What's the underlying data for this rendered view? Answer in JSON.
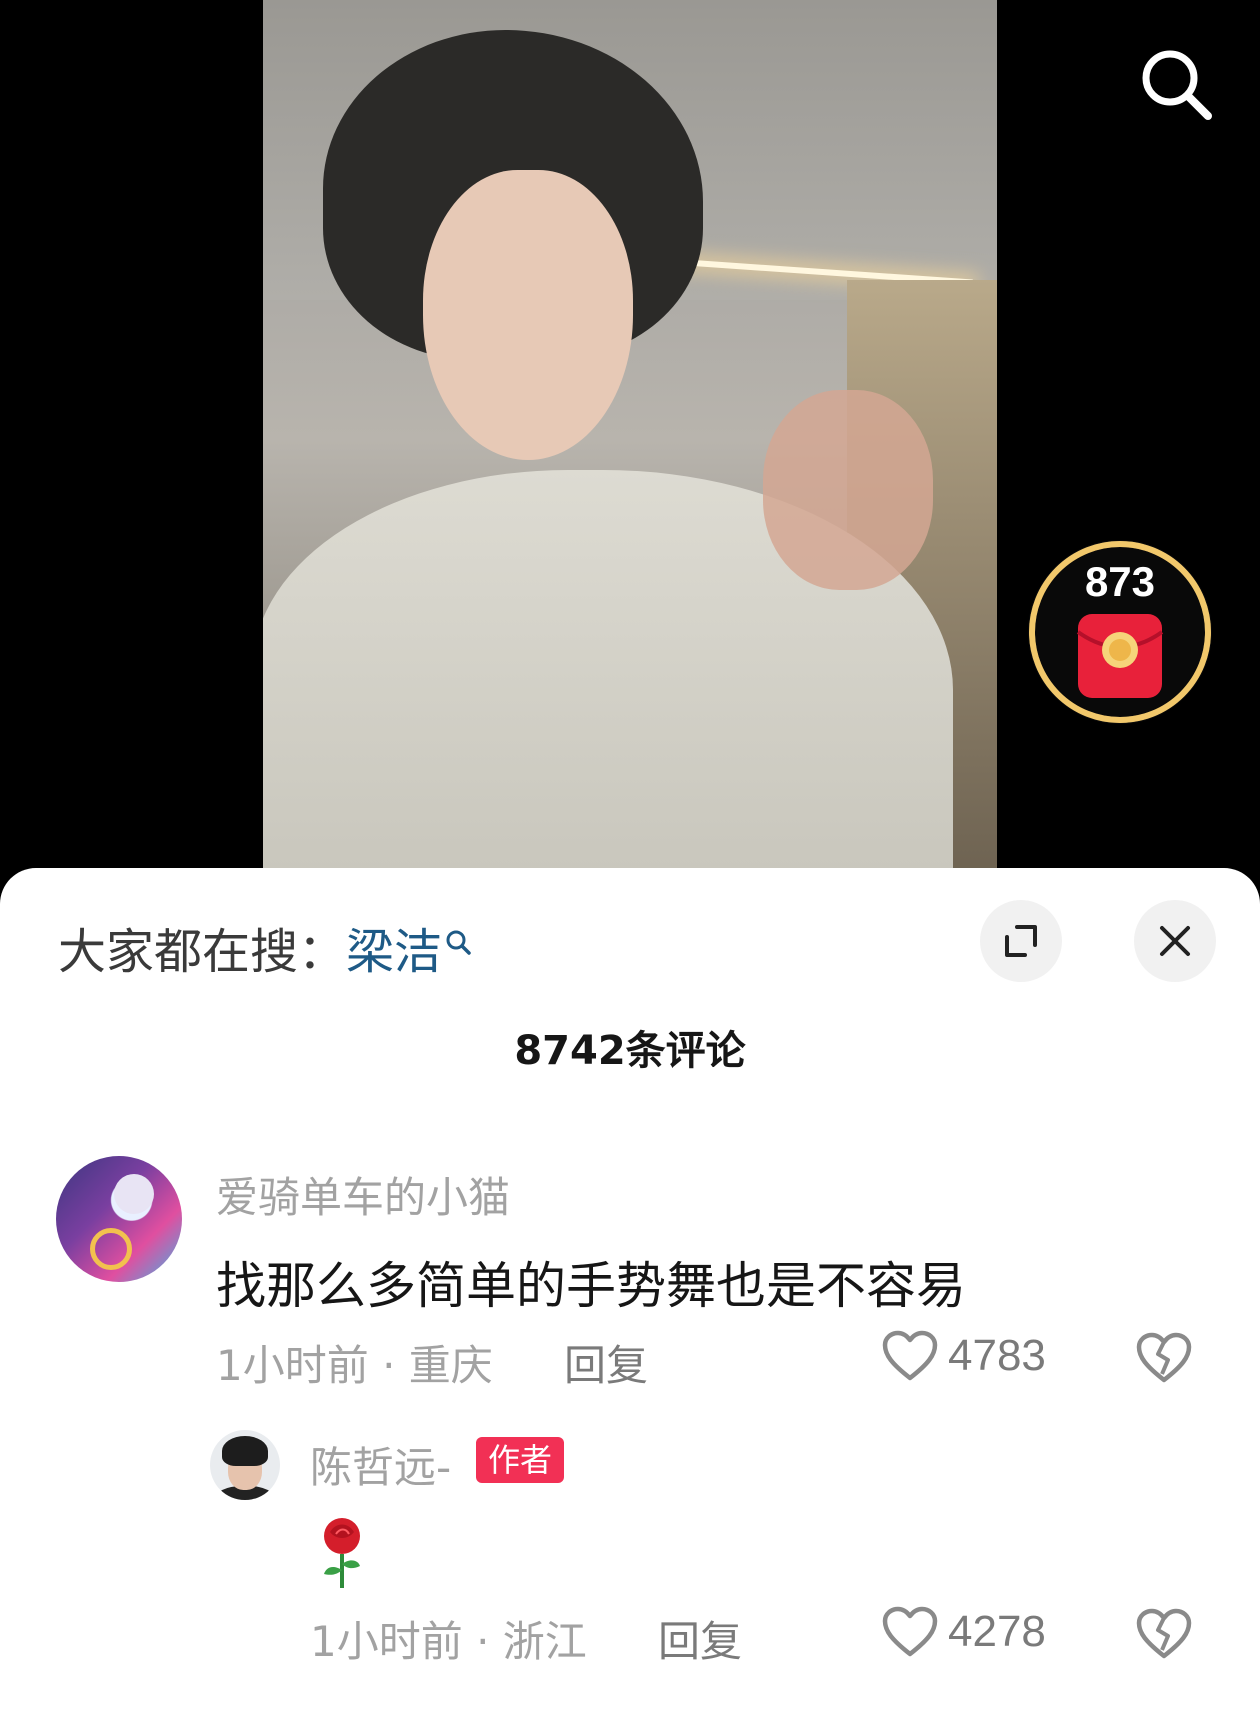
{
  "video": {
    "redpacket_count": "873"
  },
  "header": {
    "hot_search_prefix": "大家都在搜：",
    "hot_search_keyword": "梁洁"
  },
  "comments_header": {
    "count_label": "8742条评论"
  },
  "comments": [
    {
      "username": "爱骑单车的小猫",
      "text": "找那么多简单的手势舞也是不容易",
      "time_location": "1小时前 · 重庆",
      "reply_label": "回复",
      "likes": "4783"
    },
    {
      "username": "陈哲远-",
      "badge": "作者",
      "text_emoji": "rose",
      "time_location": "1小时前 · 浙江",
      "reply_label": "回复",
      "likes": "4278"
    }
  ],
  "colors": {
    "keyword": "#1e5a86",
    "badge": "#f23055",
    "redpacket": "#e8213a",
    "progress_ring": "#f2c86b"
  },
  "icons": {
    "search": "search-icon",
    "expand": "expand-icon",
    "close": "close-icon",
    "like": "heart-icon",
    "dislike": "broken-heart-icon"
  }
}
